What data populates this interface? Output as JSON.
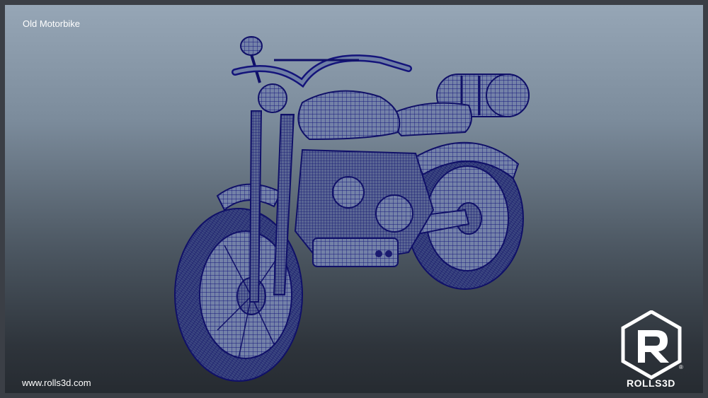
{
  "viewport": {
    "title": "Old Motorbike",
    "website": "www.rolls3d.com"
  },
  "brand": {
    "name": "ROLLS3D",
    "logo_icon": "rolls3d-logo-icon",
    "registered_mark": "®"
  },
  "model": {
    "icon": "motorbike-wireframe",
    "wire_color": "#14147a",
    "fill_color": "#6f7fa6"
  }
}
